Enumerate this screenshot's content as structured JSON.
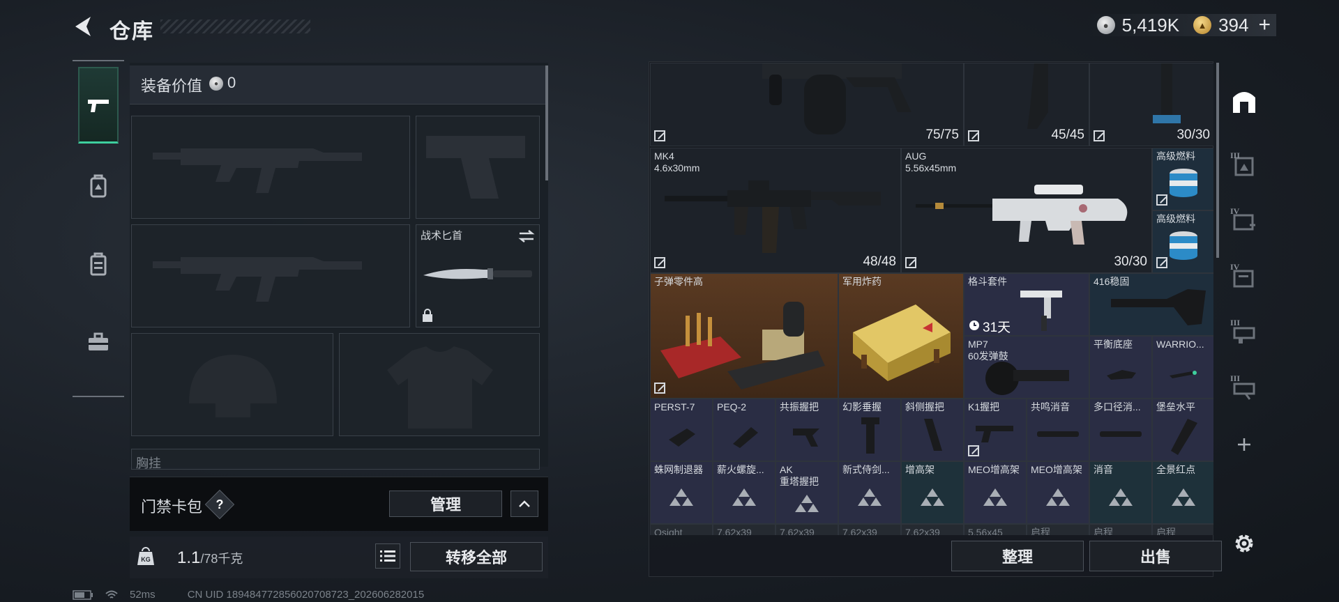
{
  "header": {
    "title": "仓库",
    "currency": [
      {
        "icon": "silver-coin-icon",
        "value": "5,419K"
      },
      {
        "icon": "gold-coin-icon",
        "value": "394"
      }
    ],
    "add_label": "+"
  },
  "left_rail": {
    "items": [
      {
        "icon": "pistol-icon",
        "active": true
      },
      {
        "icon": "backpack-icon",
        "active": false
      },
      {
        "icon": "vest-icon",
        "active": false
      },
      {
        "icon": "toolbox-icon",
        "active": false
      }
    ]
  },
  "equipment": {
    "value_label": "装备价值",
    "value": "0",
    "knife_label": "战术匕首",
    "chest_label": "胸挂",
    "keybag_label": "门禁卡包",
    "keybag_help": "?",
    "manage_label": "管理",
    "weight_value": "1.1",
    "weight_max": "/78千克",
    "transfer_all_label": "转移全部"
  },
  "stash": {
    "top_counts": [
      "75/75",
      "45/45",
      "30/30"
    ],
    "items": [
      {
        "id": "mk4",
        "name": "MK4",
        "sub": "4.6x30mm",
        "count": "48/48"
      },
      {
        "id": "aug",
        "name": "AUG",
        "sub": "5.56x45mm",
        "count": "30/30"
      },
      {
        "id": "fuel1",
        "name": "高级燃料"
      },
      {
        "id": "fuel2",
        "name": "高级燃料"
      },
      {
        "id": "ammo-parts",
        "name": "子弹零件高"
      },
      {
        "id": "explosive",
        "name": "军用炸药"
      },
      {
        "id": "fight-kit",
        "name": "格斗套件",
        "timer": "31天"
      },
      {
        "id": "stock416",
        "name": "416稳固"
      },
      {
        "id": "mp7mag",
        "name": "MP7",
        "sub": "60发弹鼓"
      },
      {
        "id": "balance-base",
        "name": "平衡底座"
      },
      {
        "id": "warrior",
        "name": "WARRIO..."
      },
      {
        "id": "perst",
        "name": "PERST-7"
      },
      {
        "id": "peq",
        "name": "PEQ-2"
      },
      {
        "id": "resonance-grip",
        "name": "共振握把"
      },
      {
        "id": "phantom-grip",
        "name": "幻影垂握"
      },
      {
        "id": "angled-grip",
        "name": "斜侧握把"
      },
      {
        "id": "k1-grip",
        "name": "K1握把"
      },
      {
        "id": "resonance-sup",
        "name": "共鸣消音"
      },
      {
        "id": "multi-caliber",
        "name": "多口径消..."
      },
      {
        "id": "fort-level",
        "name": "堡垒水平"
      },
      {
        "id": "spider-brake",
        "name": "蛛网制退器"
      },
      {
        "id": "firewood-spiral",
        "name": "薪火螺旋..."
      },
      {
        "id": "ak-tower",
        "name": "AK",
        "sub": "重塔握把"
      },
      {
        "id": "new-samurai",
        "name": "新式侍剑..."
      },
      {
        "id": "riser",
        "name": "增高架"
      },
      {
        "id": "meo-riser1",
        "name": "MEO增高架"
      },
      {
        "id": "meo-riser2",
        "name": "MEO增高架"
      },
      {
        "id": "suppressor",
        "name": "消音"
      },
      {
        "id": "panoramic-dot",
        "name": "全景红点"
      }
    ],
    "bottom_row": [
      "Osight",
      "7.62x39",
      "7.62x39",
      "7.62x39",
      "7.62x39",
      "5.56x45",
      "启程",
      "启程",
      "启程"
    ],
    "sort_label": "整理",
    "sell_label": "出售"
  },
  "status_bar": {
    "ping": "52ms",
    "uid": "CN UID 18948477285602070872​3_202606282015"
  },
  "colors": {
    "accent": "#3ecf9e",
    "purple_rarity": "#2a2d44",
    "blue_rarity": "#1e2e3c",
    "orange_rarity": "#5a3a22"
  }
}
